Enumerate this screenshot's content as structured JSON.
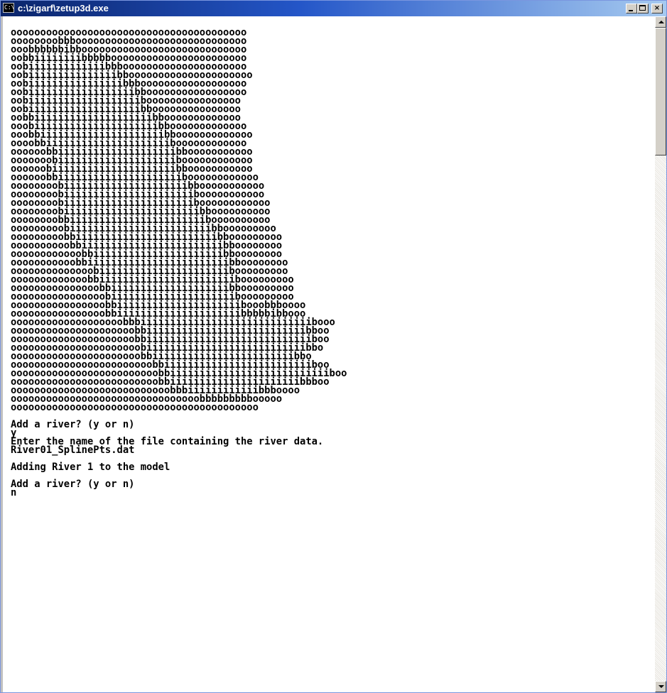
{
  "window": {
    "title": "c:\\zigarf\\zetup3d.exe",
    "icon": "console-icon",
    "icon_glyph": "C:\\",
    "buttons": {
      "minimize": "minimize-icon",
      "maximize": "maximize-icon",
      "close_label": "×"
    }
  },
  "console": {
    "lines": [
      "oooooooooooooooooooooooooooooooooooooooo",
      "oooooooobbbooooooooooooooooooooooooooooo",
      "ooobbbbbbibboooooooooooooooooooooooooooo",
      "oobbiiiiiiiibbbbbooooooooooooooooooooooo",
      "oobiiiiiiiiiiiiibbbooooooooooooooooooooo",
      "oobiiiiiiiiiiiiiiibbooooooooooooooooooooo",
      "oobiiiiiiiiiiiiiiiibbboooooooooooooooooo",
      "oobiiiiiiiiiiiiiiiiiibbooooooooooooooooo",
      "oobiiiiiiiiiiiiiiiiiiiboooooooooooooooo",
      "oobiiiiiiiiiiiiiiiiiiibbooooooooooooooo",
      "oobbiiiiiiiiiiiiiiiiiiiibbooooooooooooo",
      "ooobiiiiiiiiiiiiiiiiiiiiibbooooooooooooo",
      "ooobbiiiiiiiiiiiiiiiiiiiiibbooooooooooooo",
      "oooobbiiiiiiiiiiiiiiiiiiiiiboooooooooooo",
      "oooooobbiiiiiiiiiiiiiiiiiiiibbooooooooooo",
      "ooooooobiiiiiiiiiiiiiiiiiiiiboooooooooooo",
      "oooooobiiiiiiiiiiiiiiiiiiiiibbooooooooooo",
      "oooooobbiiiiiiiiiiiiiiiiiiiiiboooooooooooo",
      "oooooooobiiiiiiiiiiiiiiiiiiiiibbooooooooooo",
      "oooooooobiiiiiiiiiiiiiiiiiiiiiibooooooooooo",
      "oooooooobiiiiiiiiiiiiiiiiiiiiiiboooooooooooo",
      "oooooooobiiiiiiiiiiiiiiiiiiiiiiibboooooooooo",
      "oooooooobbiiiiiiiiiiiiiiiiiiiiiiiboooooooooo",
      "ooooooooobiiiiiiiiiiiiiiiiiiiiiiiibbooooooooo",
      "ooooooooobbiiiiiiiiiiiiiiiiiiiiiiiibbooooooooo",
      "oooooooooobbiiiiiiiiiiiiiiiiiiiiiiiibboooooooo",
      "oooooooooooobbiiiiiiiiiiiiiiiiiiiiiibboooooooo",
      "ooooooooooobbiiiiiiiiiiiiiiiiiiiiiiiibboooooooo",
      "oooooooooooooobiiiiiiiiiiiiiiiiiiiiiibooooooooo",
      "ooooooooooooobbiiiiiiiiiiiiiiiiiiiiiiibooooooooo",
      "ooooooooooooooobbiiiiiiiiiiiiiiiiiiiibbooooooooo",
      "oooooooooooooooobiiiiiiiiiiiiiiiiiiiiibooooooooo",
      "oooooooooooooooobbiiiiiiiiiiiiiiiiiiiiibooobbboooo",
      "oooooooooooooooobbiiiiiiiiiiiiiiiiiiiiibbbbbibbooo",
      "ooooooooooooooooooobbbiiiiiiiiiiiiiiiiiiiiiiiiiiiiibooo",
      "ooooooooooooooooooooobbiiiiiiiiiiiiiiiiiiiiiiiiiiibboo",
      "ooooooooooooooooooooobbiiiiiiiiiiiiiiiiiiiiiiiiiiiiboo",
      "oooooooooooooooooooooobiiiiiiiiiiiiiiiiiiiiiiiiiiibbo",
      "oooooooooooooooooooooobbiiiiiiiiiiiiiiiiiiiiiiiibbo",
      "oooooooooooooooooooooooobbiiiiiiiiiiiiiiiiiiiiiiiiiboo",
      "ooooooooooooooooooooooooobbiiiiiiiiiiiiiiiiiiiiiiiiiiiboo",
      "ooooooooooooooooooooooooobbiiiiiiiiiiiiiiiiiiiiiibbboo",
      "ooooooooooooooooooooooooooobbbiiiiiiiiiiiibbboooo",
      "oooooooooooooooooooooooooooooooobbbbbbbbbooooo",
      "oooooooooooooooooooooooooooooooooooooooooo",
      "",
      "Add a river? (y or n)",
      "y",
      "Enter the name of the file containing the river data.",
      "River01_SplinePts.dat",
      "",
      "Adding River 1 to the model",
      "",
      "Add a river? (y or n)",
      "n"
    ]
  },
  "scrollbar": {
    "up_icon": "scroll-up-arrow-icon",
    "down_icon": "scroll-down-arrow-icon",
    "position": 0
  }
}
